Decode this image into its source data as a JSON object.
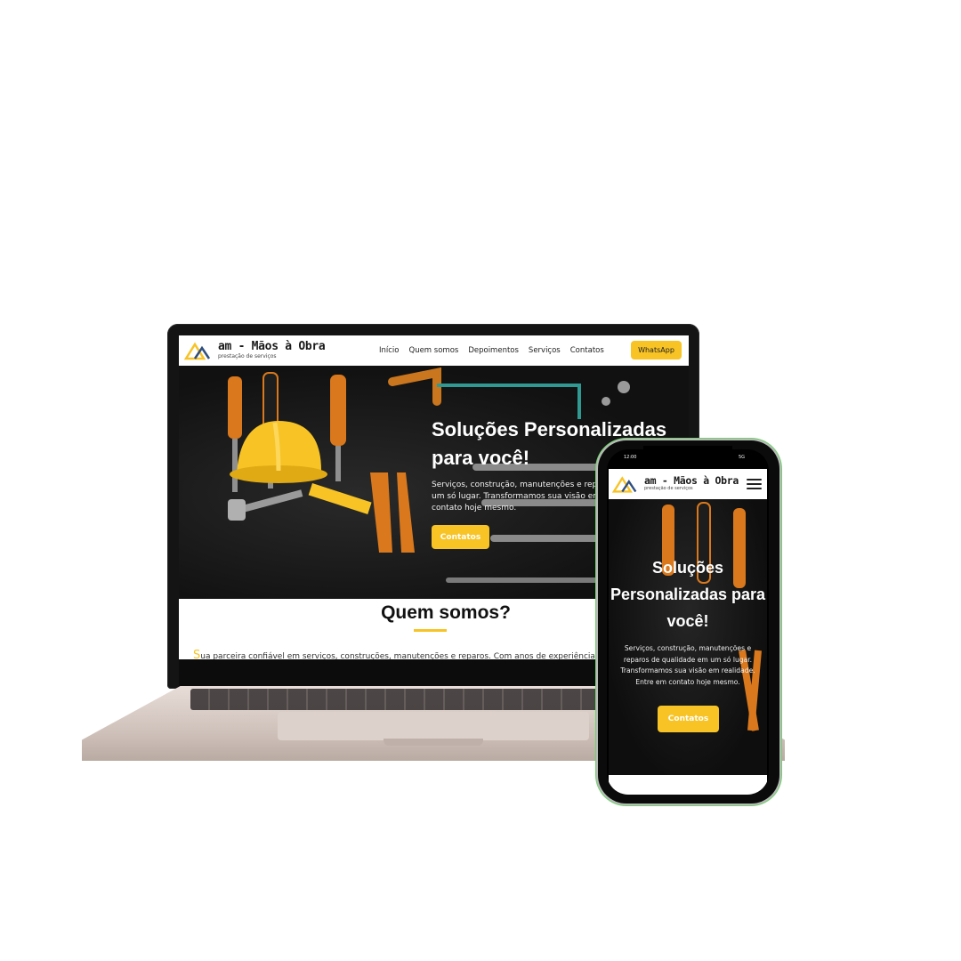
{
  "brand": {
    "name": "am - Mãos à Obra",
    "tagline": "prestação de serviços"
  },
  "nav": {
    "items": [
      "Início",
      "Quem somos",
      "Depoimentos",
      "Serviços",
      "Contatos"
    ],
    "cta_label": "WhatsApp"
  },
  "hero": {
    "title_desktop": "Soluções Personalizadas para você!",
    "text_desktop": "Serviços, construção, manutenções e reparos de qualidade em um só lugar. Transformamos sua visão em realidade. Entre em contato hoje mesmo.",
    "title_mobile": "Soluções Personalizadas para você!",
    "text_mobile": "Serviços, construção, manutenções e reparos de qualidade em um só lugar. Transformamos sua visão em realidade. Entre em contato hoje mesmo.",
    "button_label": "Contatos"
  },
  "about": {
    "title": "Quem somos?",
    "first_letter": "S",
    "text": "ua parceira confiável em serviços, construções, manutenções e reparos. Com anos de experiência no"
  },
  "phone_status": {
    "time": "12:00",
    "signal": "5G"
  },
  "colors": {
    "accent": "#f7c325",
    "hero_bg": "#141414",
    "text_dark": "#111111"
  }
}
